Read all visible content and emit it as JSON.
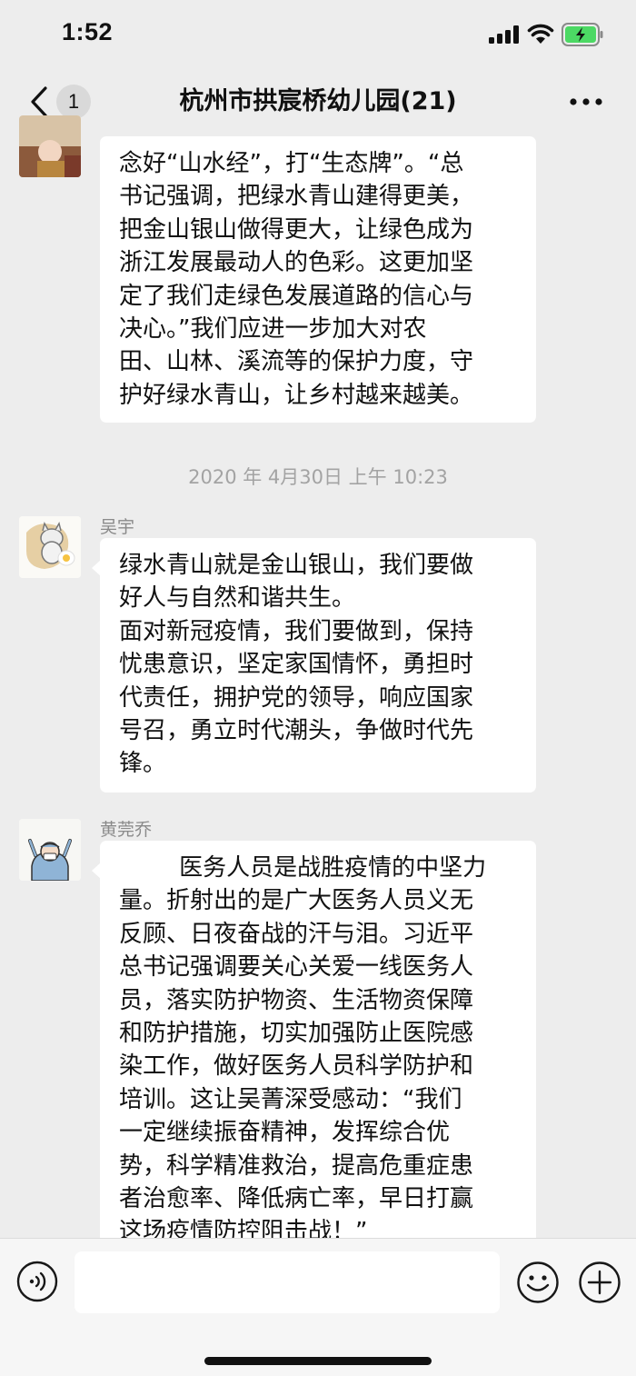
{
  "status_bar": {
    "time": "1:52"
  },
  "nav": {
    "unread_count": "1",
    "title": "杭州市拱宸桥幼儿园(21)"
  },
  "messages": [
    {
      "sender": "",
      "avatar": "photo-avatar",
      "text": "念好“山水经”，打“生态牌”。“总\n书记强调，把绿水青山建得更美，\n把金山银山做得更大，让绿色成为\n浙江发展最动人的色彩。这更加坚\n定了我们走绿色发展道路的信心与\n决心。”我们应进一步加大对农\n田、山林、溪流等的保护力度，守\n护好绿水青山，让乡村越来越美。"
    },
    {
      "sender": "吴宇",
      "avatar": "cat-avatar",
      "text": "绿水青山就是金山银山，我们要做\n好人与自然和谐共生。\n面对新冠疫情，我们要做到，保持\n忧患意识，坚定家国情怀，勇担时\n代责任，拥护党的领导，响应国家\n号召，勇立时代潮头，争做时代先\n锋。"
    },
    {
      "sender": "黄莞乔",
      "avatar": "medic-avatar",
      "text": "        医务人员是战胜疫情的中坚力\n量。折射出的是广大医务人员义无\n反顾、日夜奋战的汗与泪。习近平\n总书记强调要关心关爱一线医务人\n员，落实防护物资、生活物资保障\n和防护措施，切实加强防止医院感\n染工作，做好医务人员科学防护和\n培训。这让吴菁深受感动：“我们\n一定继续振奋精神，发挥综合优\n势，科学精准救治，提高危重症患\n者治愈率、降低病亡率，早日打赢\n这场疫情防控阻击战！”"
    }
  ],
  "timestamp": "2020 年 4月30日 上午 10:23",
  "input_bar": {
    "placeholder": ""
  },
  "colors": {
    "background": "#ededed",
    "bubble": "#ffffff",
    "battery_green": "#4cd964"
  },
  "icons": [
    "signal-icon",
    "wifi-icon",
    "battery-icon",
    "back-icon",
    "more-icon",
    "voice-icon",
    "emoji-icon",
    "plus-icon"
  ]
}
